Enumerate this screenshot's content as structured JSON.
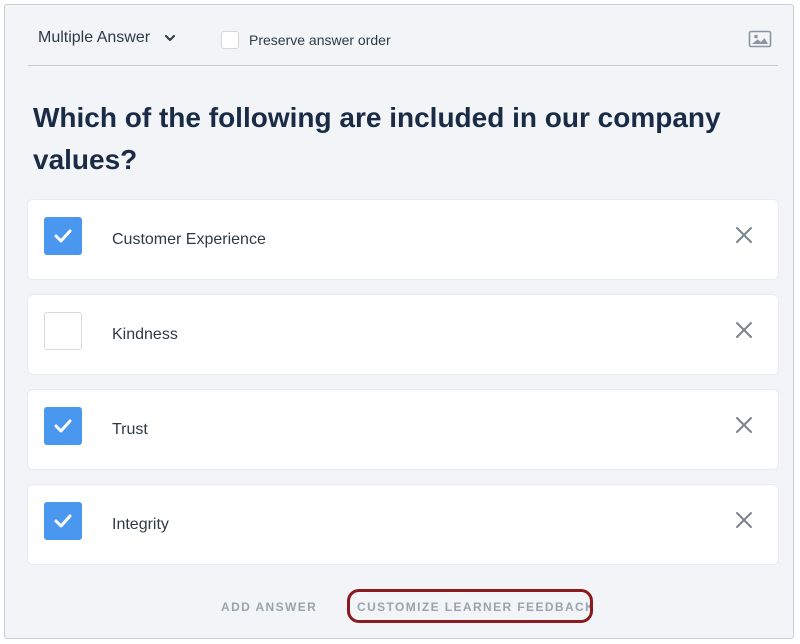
{
  "toolbar": {
    "question_type": "Multiple Answer",
    "preserve_order_label": "Preserve answer order",
    "preserve_order_checked": false,
    "type_icon": "chevron-down-icon",
    "image_icon": "image-icon"
  },
  "question": {
    "text": "Which of the following are included in our company values?"
  },
  "answers": [
    {
      "label": "Customer Experience",
      "checked": true
    },
    {
      "label": "Kindness",
      "checked": false
    },
    {
      "label": "Trust",
      "checked": true
    },
    {
      "label": "Integrity",
      "checked": true
    }
  ],
  "footer": {
    "add_answer": "ADD ANSWER",
    "customize_feedback": "CUSTOMIZE LEARNER FEEDBACK"
  },
  "colors": {
    "checkbox_checked": "#4a97f0",
    "highlight_border": "#8b1a1f",
    "question_text": "#192b45"
  }
}
